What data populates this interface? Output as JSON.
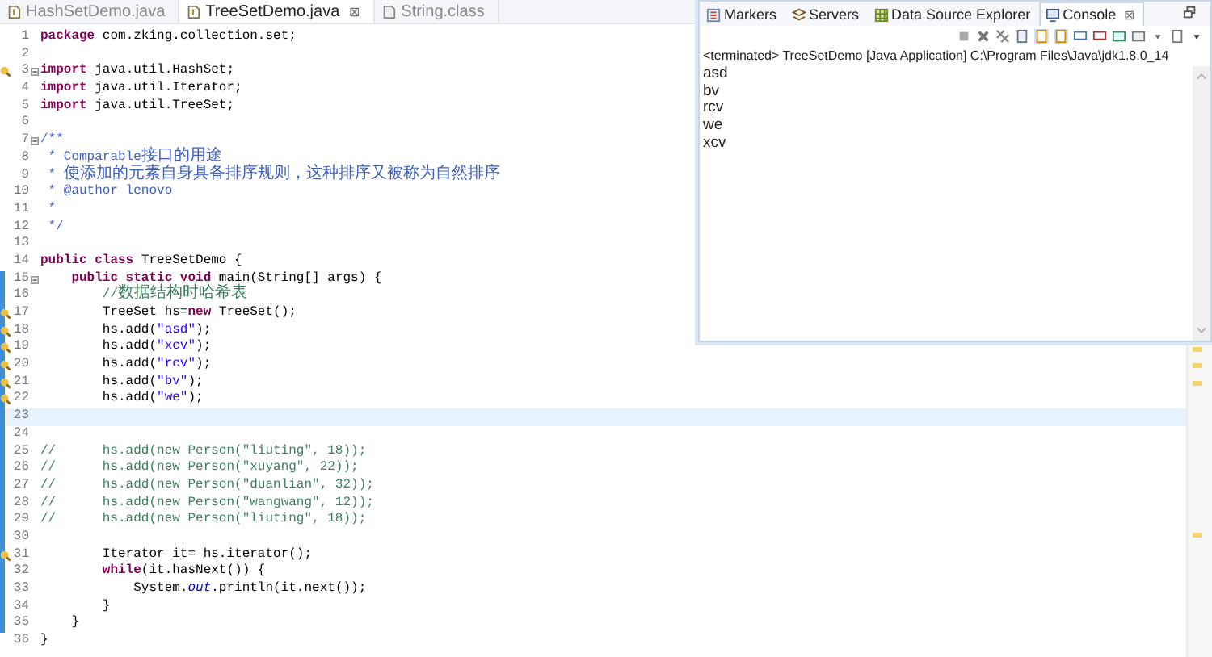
{
  "editor": {
    "tabs": [
      {
        "label": "HashSetDemo.java",
        "kind": "java",
        "selected": false,
        "closable": false
      },
      {
        "label": "TreeSetDemo.java",
        "kind": "java",
        "selected": true,
        "closable": true
      },
      {
        "label": "String.class",
        "kind": "class",
        "selected": false,
        "closable": false
      }
    ],
    "close_glyph": "⊠",
    "lines": [
      {
        "number": "1",
        "warning": false,
        "fold": false,
        "changed": false,
        "current": false,
        "tokens": [
          {
            "kind": "keyword",
            "text": "package"
          },
          {
            "kind": "plain",
            "text": " com.zking.collection.set;"
          }
        ]
      },
      {
        "number": "2",
        "warning": false,
        "fold": false,
        "changed": false,
        "current": false
      },
      {
        "number": "3",
        "warning": true,
        "fold": true,
        "changed": false,
        "current": false,
        "tokens": [
          {
            "kind": "keyword",
            "text": "import"
          },
          {
            "kind": "plain",
            "text": " java.util.HashSet;"
          }
        ]
      },
      {
        "number": "4",
        "warning": false,
        "fold": false,
        "changed": false,
        "current": false,
        "tokens": [
          {
            "kind": "keyword",
            "text": "import"
          },
          {
            "kind": "plain",
            "text": " java.util.Iterator;"
          }
        ]
      },
      {
        "number": "5",
        "warning": false,
        "fold": false,
        "changed": false,
        "current": false,
        "tokens": [
          {
            "kind": "keyword",
            "text": "import"
          },
          {
            "kind": "plain",
            "text": " java.util.TreeSet;"
          }
        ]
      },
      {
        "number": "6",
        "warning": false,
        "fold": false,
        "changed": false,
        "current": false
      },
      {
        "number": "7",
        "warning": false,
        "fold": true,
        "changed": false,
        "current": false,
        "tokens": [
          {
            "kind": "doc",
            "text": "/**"
          }
        ]
      },
      {
        "number": "8",
        "warning": false,
        "fold": false,
        "changed": false,
        "current": false,
        "tokens": [
          {
            "kind": "doc",
            "text": " * Comparable接口的用途"
          }
        ]
      },
      {
        "number": "9",
        "warning": false,
        "fold": false,
        "changed": false,
        "current": false,
        "tokens": [
          {
            "kind": "doc",
            "text": " * 使添加的元素自身具备排序规则，这种排序又被称为自然排序"
          }
        ]
      },
      {
        "number": "10",
        "warning": false,
        "fold": false,
        "changed": false,
        "current": false,
        "tokens": [
          {
            "kind": "doc",
            "text": " * @author lenovo"
          }
        ]
      },
      {
        "number": "11",
        "warning": false,
        "fold": false,
        "changed": false,
        "current": false,
        "tokens": [
          {
            "kind": "doc",
            "text": " *"
          }
        ]
      },
      {
        "number": "12",
        "warning": false,
        "fold": false,
        "changed": false,
        "current": false,
        "tokens": [
          {
            "kind": "doc",
            "text": " */"
          }
        ]
      },
      {
        "number": "13",
        "warning": false,
        "fold": false,
        "changed": false,
        "current": false
      },
      {
        "number": "14",
        "warning": false,
        "fold": false,
        "changed": false,
        "current": false,
        "tokens": [
          {
            "kind": "keyword",
            "text": "public class"
          },
          {
            "kind": "plain",
            "text": " TreeSetDemo {"
          }
        ]
      },
      {
        "number": "15",
        "warning": false,
        "fold": true,
        "changed": true,
        "current": false,
        "tokens": [
          {
            "kind": "keyword",
            "text": "    public static void"
          },
          {
            "kind": "plain",
            "text": " main(String[] args) {"
          }
        ]
      },
      {
        "number": "16",
        "warning": false,
        "fold": false,
        "changed": true,
        "current": false,
        "tokens": [
          {
            "kind": "comment",
            "text": "        //数据结构时哈希表"
          }
        ]
      },
      {
        "number": "17",
        "warning": true,
        "fold": false,
        "changed": true,
        "current": false,
        "tokens": [
          {
            "kind": "plain",
            "text": "        TreeSet hs="
          },
          {
            "kind": "keyword",
            "text": "new"
          },
          {
            "kind": "plain",
            "text": " TreeSet();"
          }
        ]
      },
      {
        "number": "18",
        "warning": true,
        "fold": false,
        "changed": true,
        "current": false,
        "tokens": [
          {
            "kind": "plain",
            "text": "        hs.add("
          },
          {
            "kind": "string",
            "text": "\"asd\""
          },
          {
            "kind": "plain",
            "text": ");"
          }
        ]
      },
      {
        "number": "19",
        "warning": true,
        "fold": false,
        "changed": true,
        "current": false,
        "tokens": [
          {
            "kind": "plain",
            "text": "        hs.add("
          },
          {
            "kind": "string",
            "text": "\"xcv\""
          },
          {
            "kind": "plain",
            "text": ");"
          }
        ]
      },
      {
        "number": "20",
        "warning": true,
        "fold": false,
        "changed": true,
        "current": false,
        "tokens": [
          {
            "kind": "plain",
            "text": "        hs.add("
          },
          {
            "kind": "string",
            "text": "\"rcv\""
          },
          {
            "kind": "plain",
            "text": ");"
          }
        ]
      },
      {
        "number": "21",
        "warning": true,
        "fold": false,
        "changed": true,
        "current": false,
        "tokens": [
          {
            "kind": "plain",
            "text": "        hs.add("
          },
          {
            "kind": "string",
            "text": "\"bv\""
          },
          {
            "kind": "plain",
            "text": ");"
          }
        ]
      },
      {
        "number": "22",
        "warning": true,
        "fold": false,
        "changed": true,
        "current": false,
        "tokens": [
          {
            "kind": "plain",
            "text": "        hs.add("
          },
          {
            "kind": "string",
            "text": "\"we\""
          },
          {
            "kind": "plain",
            "text": ");"
          }
        ]
      },
      {
        "number": "23",
        "warning": false,
        "fold": false,
        "changed": true,
        "current": true
      },
      {
        "number": "24",
        "warning": false,
        "fold": false,
        "changed": true,
        "current": false
      },
      {
        "number": "25",
        "warning": false,
        "fold": false,
        "changed": true,
        "current": false,
        "tokens": [
          {
            "kind": "comment",
            "text": "//      hs.add(new Person(\"liuting\", 18));"
          }
        ]
      },
      {
        "number": "26",
        "warning": false,
        "fold": false,
        "changed": true,
        "current": false,
        "tokens": [
          {
            "kind": "comment",
            "text": "//      hs.add(new Person(\"xuyang\", 22));"
          }
        ]
      },
      {
        "number": "27",
        "warning": false,
        "fold": false,
        "changed": true,
        "current": false,
        "tokens": [
          {
            "kind": "comment",
            "text": "//      hs.add(new Person(\"duanlian\", 32));"
          }
        ]
      },
      {
        "number": "28",
        "warning": false,
        "fold": false,
        "changed": true,
        "current": false,
        "tokens": [
          {
            "kind": "comment",
            "text": "//      hs.add(new Person(\"wangwang\", 12));"
          }
        ]
      },
      {
        "number": "29",
        "warning": false,
        "fold": false,
        "changed": true,
        "current": false,
        "tokens": [
          {
            "kind": "comment",
            "text": "//      hs.add(new Person(\"liuting\", 18));"
          }
        ]
      },
      {
        "number": "30",
        "warning": false,
        "fold": false,
        "changed": true,
        "current": false
      },
      {
        "number": "31",
        "warning": true,
        "fold": false,
        "changed": true,
        "current": false,
        "tokens": [
          {
            "kind": "plain",
            "text": "        Iterator it= hs.iterator();"
          }
        ]
      },
      {
        "number": "32",
        "warning": false,
        "fold": false,
        "changed": true,
        "current": false,
        "tokens": [
          {
            "kind": "keyword",
            "text": "        while"
          },
          {
            "kind": "plain",
            "text": "(it.hasNext()) {"
          }
        ]
      },
      {
        "number": "33",
        "warning": false,
        "fold": false,
        "changed": true,
        "current": false,
        "tokens": [
          {
            "kind": "plain",
            "text": "            System."
          },
          {
            "kind": "field",
            "text": "out"
          },
          {
            "kind": "plain",
            "text": ".println(it.next());"
          }
        ]
      },
      {
        "number": "34",
        "warning": false,
        "fold": false,
        "changed": true,
        "current": false,
        "tokens": [
          {
            "kind": "plain",
            "text": "        }"
          }
        ]
      },
      {
        "number": "35",
        "warning": false,
        "fold": false,
        "changed": true,
        "current": false,
        "tokens": [
          {
            "kind": "plain",
            "text": "    }"
          }
        ]
      },
      {
        "number": "36",
        "warning": false,
        "fold": false,
        "changed": false,
        "current": false,
        "tokens": [
          {
            "kind": "plain",
            "text": "}"
          }
        ]
      }
    ]
  },
  "console": {
    "tabs": [
      {
        "label": "Markers",
        "kind": "markers",
        "selected": false
      },
      {
        "label": "Servers",
        "kind": "servers",
        "selected": false
      },
      {
        "label": "Data Source Explorer",
        "kind": "data",
        "selected": false
      },
      {
        "label": "Console",
        "kind": "console",
        "selected": true
      }
    ],
    "close_glyph": "⊠",
    "status": "<terminated> TreeSetDemo [Java Application] C:\\Program Files\\Java\\jdk1.8.0_14",
    "output": [
      "asd",
      "bv",
      "rcv",
      "we",
      "xcv"
    ]
  }
}
